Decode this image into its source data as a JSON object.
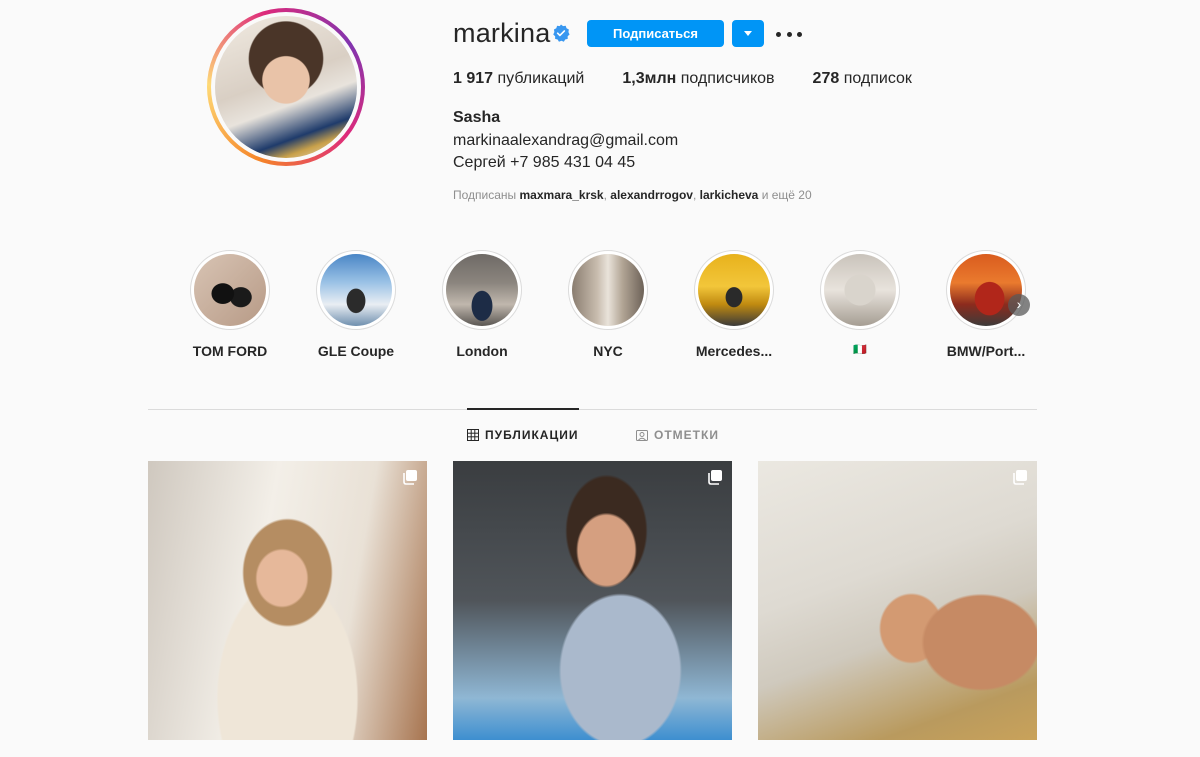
{
  "profile": {
    "username": "markina",
    "follow_label": "Подписаться",
    "stats": {
      "posts_count": "1 917",
      "posts_label": "публикаций",
      "followers_count": "1,3млн",
      "followers_label": "подписчиков",
      "following_count": "278",
      "following_label": "подписок"
    },
    "full_name": "Sasha",
    "bio_line1": "markinaalexandrag@gmail.com",
    "bio_line2": "Сергей +7 985 431 04 45",
    "followed_by": {
      "prefix": "Подписаны",
      "accounts": [
        "maxmara_krsk",
        "alexandrrogov",
        "larkicheva"
      ],
      "suffix": "и ещё 20"
    }
  },
  "highlights": [
    {
      "label": "TOM FORD"
    },
    {
      "label": "GLE Coupe"
    },
    {
      "label": "London"
    },
    {
      "label": "NYC"
    },
    {
      "label": "Mercedes..."
    },
    {
      "label": "🇮🇹"
    },
    {
      "label": "BMW/Port..."
    }
  ],
  "tabs": {
    "posts": "ПУБЛИКАЦИИ",
    "tagged": "ОТМЕТКИ"
  },
  "colors": {
    "accent": "#0095f6",
    "text": "#262626",
    "muted": "#8e8e8e",
    "border": "#dbdbdb",
    "background": "#fafafa"
  },
  "icons": {
    "verified": "verified-badge-icon",
    "more": "more-options-icon",
    "grid": "grid-icon",
    "tagged": "tagged-icon",
    "multiple": "multiple-images-icon",
    "next": "chevron-right-icon"
  }
}
